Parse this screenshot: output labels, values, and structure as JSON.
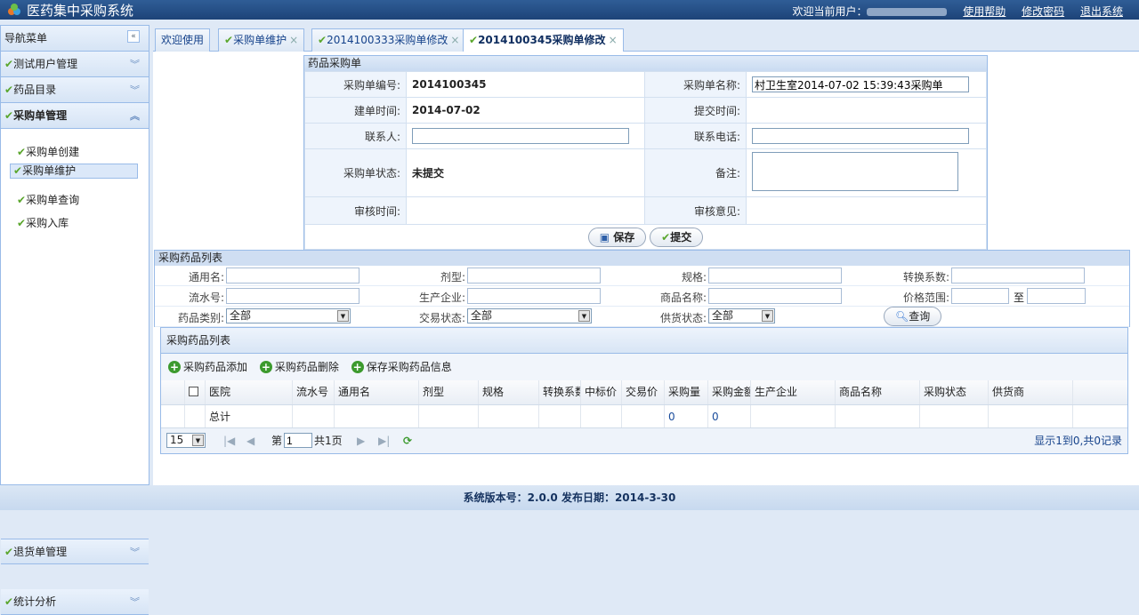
{
  "header": {
    "title": "医药集中采购系统",
    "welcome": "欢迎当前用户：",
    "links": [
      "使用帮助",
      "修改密码",
      "退出系统"
    ]
  },
  "sidebar": {
    "title": "导航菜单",
    "menus": [
      "测试用户管理",
      "药品目录",
      "采购单管理"
    ],
    "sub_items": [
      "采购单创建",
      "采购单维护",
      "采购单查询",
      "采购入库"
    ],
    "bottom_menus": [
      "退货单管理",
      "统计分析"
    ]
  },
  "tabs": [
    "欢迎使用",
    "采购单维护",
    "2014100333采购单修改",
    "2014100345采购单修改"
  ],
  "form": {
    "caption": "药品采购单",
    "rows": [
      [
        "采购单编号:",
        "2014100345",
        "采购单名称:",
        "村卫生室2014-07-02 15:39:43采购单"
      ],
      [
        "建单时间:",
        "2014-07-02",
        "提交时间:",
        ""
      ],
      [
        "联系人:",
        "",
        "联系电话:",
        ""
      ],
      [
        "采购单状态:",
        "未提交",
        "备注:",
        ""
      ],
      [
        "审核时间:",
        "",
        "审核意见:",
        ""
      ]
    ],
    "save": "保存",
    "submit": "提交"
  },
  "search": {
    "caption": "采购药品列表",
    "labels": [
      "通用名:",
      "剂型:",
      "规格:",
      "转换系数:",
      "流水号:",
      "生产企业:",
      "商品名称:",
      "价格范围:",
      "药品类别:",
      "交易状态:",
      "供货状态:"
    ],
    "to": "至",
    "selects": [
      "全部",
      "全部",
      "全部"
    ],
    "query": "查询"
  },
  "grid": {
    "caption": "采购药品列表",
    "toolbar": [
      "采购药品添加",
      "采购药品删除",
      "保存采购药品信息"
    ],
    "columns": [
      "医院",
      "流水号",
      "通用名",
      "剂型",
      "规格",
      "转换系数",
      "中标价",
      "交易价",
      "采购量",
      "采购金额",
      "生产企业",
      "商品名称",
      "采购状态",
      "供货商"
    ],
    "total_row": {
      "label": "总计",
      "qty": "0",
      "amount": "0"
    },
    "pager": {
      "page_size": "15",
      "page_prefix": "第",
      "page": "1",
      "page_total": "共1页",
      "summary": "显示1到0,共0记录"
    }
  },
  "footer": "系统版本号：2.0.0   发布日期：2014-3-30"
}
